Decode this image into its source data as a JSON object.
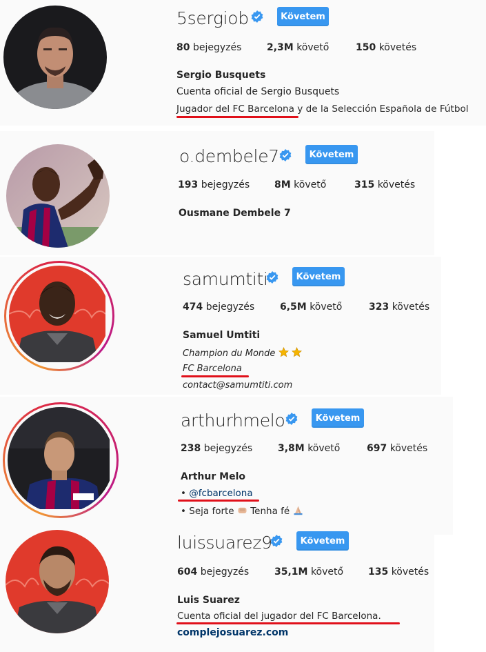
{
  "profiles": [
    {
      "username": "5sergiob",
      "follow_label": "Követem",
      "posts": "80",
      "posts_label": "bejegyzés",
      "followers": "2,3M",
      "followers_label": "követő",
      "following": "150",
      "following_label": "követés",
      "full_name": "Sergio Busquets",
      "bio": [
        "Cuenta oficial de Sergio Busquets",
        "Jugador del FC Barcelona y de la Selección Española de Fútbol"
      ]
    },
    {
      "username": "o.dembele7",
      "follow_label": "Követem",
      "posts": "193",
      "posts_label": "bejegyzés",
      "followers": "8M",
      "followers_label": "követő",
      "following": "315",
      "following_label": "követés",
      "full_name": "Ousmane Dembele 7"
    },
    {
      "username": "samumtiti",
      "follow_label": "Követem",
      "posts": "474",
      "posts_label": "bejegyzés",
      "followers": "6,5M",
      "followers_label": "követő",
      "following": "323",
      "following_label": "követés",
      "full_name": "Samuel Umtiti",
      "bio": [
        "Champion du Monde",
        "FC Barcelona",
        "contact@samumtiti.com"
      ]
    },
    {
      "username": "arthurhmelo",
      "follow_label": "Követem",
      "posts": "238",
      "posts_label": "bejegyzés",
      "followers": "3,8M",
      "followers_label": "követő",
      "following": "697",
      "following_label": "követés",
      "full_name": "Arthur Melo",
      "bio": [
        "• ",
        "@fcbarcelona",
        "• Seja forte",
        "Tenha fé"
      ]
    },
    {
      "username": "luissuarez9",
      "follow_label": "Követem",
      "posts": "604",
      "posts_label": "bejegyzés",
      "followers": "35,1M",
      "followers_label": "követő",
      "following": "135",
      "following_label": "követés",
      "full_name": "Luis Suarez",
      "bio": [
        "Cuenta oficial del jugador del FC Barcelona."
      ],
      "website": "complejosuarez.com"
    }
  ],
  "colors": {
    "follow_button": "#3897f0",
    "underline": "#e0101a",
    "verified": "#3897f0",
    "link": "#003569"
  }
}
